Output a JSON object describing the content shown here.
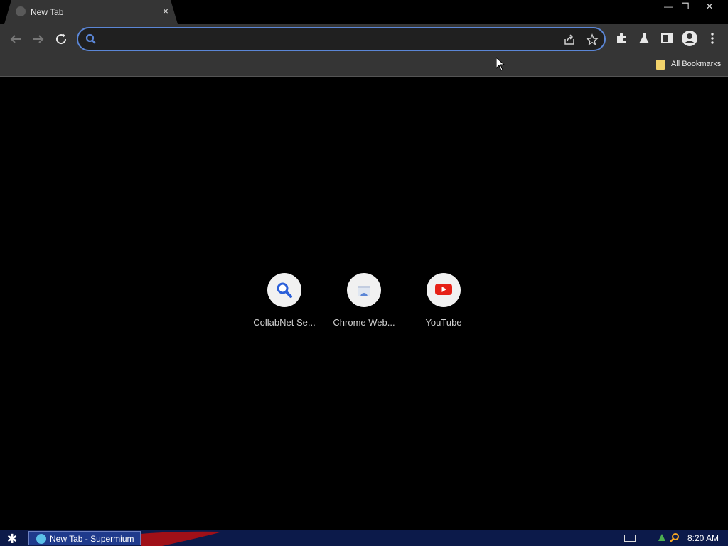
{
  "tab": {
    "title": "New Tab",
    "close": "×"
  },
  "window_controls": {
    "minimize": "—",
    "restore": "❐",
    "close": "✕"
  },
  "omnibox": {
    "value": "",
    "placeholder": ""
  },
  "bookmarks_bar": {
    "all_bookmarks": "All Bookmarks"
  },
  "shortcuts": [
    {
      "label": "CollabNet Se..."
    },
    {
      "label": "Chrome Web..."
    },
    {
      "label": "YouTube"
    }
  ],
  "taskbar": {
    "start": "✱",
    "task_label": "New Tab - Supermium",
    "clock": "8:20 AM"
  },
  "colors": {
    "accent": "#5b86d6",
    "toolbar": "#353535",
    "taskbar": "#0c1a4a",
    "youtube": "#e62117"
  }
}
